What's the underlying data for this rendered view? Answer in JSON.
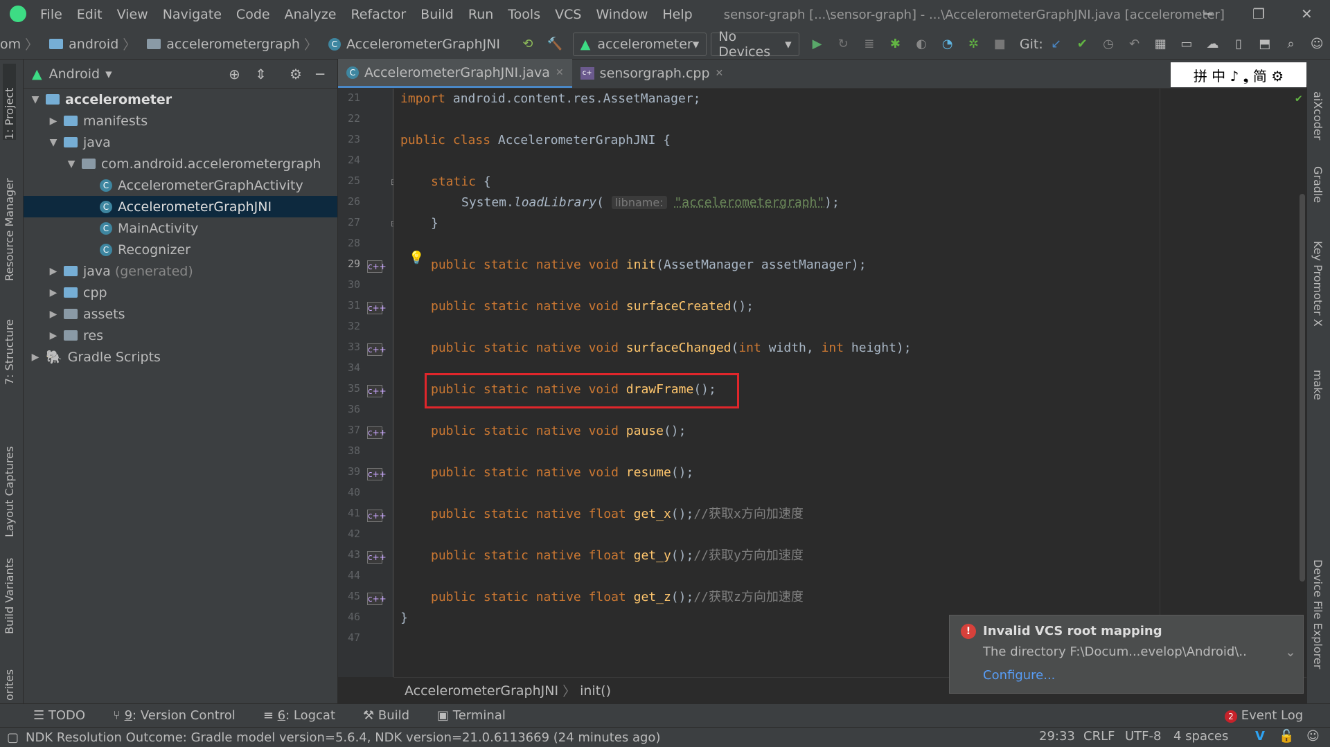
{
  "menu": [
    "File",
    "Edit",
    "View",
    "Navigate",
    "Code",
    "Analyze",
    "Refactor",
    "Build",
    "Run",
    "Tools",
    "VCS",
    "Window",
    "Help"
  ],
  "window_title": "sensor-graph [...\\sensor-graph] - ...\\AccelerometerGraphJNI.java [accelerometer]",
  "nav": {
    "crumbs": [
      "om",
      "android",
      "accelerometergraph",
      "AccelerometerGraphJNI"
    ],
    "run_config": "accelerometer",
    "device": "No Devices",
    "git_label": "Git:"
  },
  "project_panel": {
    "view": "Android",
    "tree": [
      {
        "label": "accelerometer",
        "bold": true
      },
      {
        "label": "manifests"
      },
      {
        "label": "java"
      },
      {
        "label": "com.android.accelerometergraph"
      },
      {
        "label": "AccelerometerGraphActivity"
      },
      {
        "label": "AccelerometerGraphJNI",
        "selected": true
      },
      {
        "label": "MainActivity"
      },
      {
        "label": "Recognizer"
      },
      {
        "label": "java",
        "suffix": "(generated)"
      },
      {
        "label": "cpp"
      },
      {
        "label": "assets"
      },
      {
        "label": "res"
      },
      {
        "label": "Gradle Scripts"
      }
    ]
  },
  "left_stripe": [
    "1: Project",
    "Resource Manager",
    "7: Structure",
    "Layout Captures",
    "Build Variants",
    "orites"
  ],
  "right_stripe": [
    "aiXcoder",
    "Gradle",
    "Key Promoter X",
    "make",
    "Device File Explorer"
  ],
  "tabs": [
    {
      "label": "AccelerometerGraphJNI.java",
      "active": true
    },
    {
      "label": "sensorgraph.cpp",
      "active": false
    }
  ],
  "ime_bar": "拼 中 ♪ ❟ 简 ⚙",
  "line_numbers": [
    "21",
    "22",
    "23",
    "24",
    "25",
    "26",
    "27",
    "28",
    "29",
    "30",
    "31",
    "32",
    "33",
    "34",
    "35",
    "36",
    "37",
    "38",
    "39",
    "40",
    "41",
    "42",
    "43",
    "44",
    "45",
    "46",
    "47"
  ],
  "code": {
    "l21_kw": "import",
    "l21_rest": " android.content.res.AssetManager;",
    "l23_kw": "public class",
    "l23_rest": " AccelerometerGraphJNI {",
    "l25_kw": "static",
    "l25_rest": " {",
    "l26_a": "System.",
    "l26_fn": "loadLibrary",
    "l26_paren": "(",
    "l26_hint": "libname:",
    "l26_str": "\"accelerometergraph\"",
    "l26_end": ");",
    "l27": "}",
    "l29_kw": "public static native void",
    "l29_fn": "init",
    "l29_rest": "(AssetManager assetManager);",
    "l31_kw": "public static native void",
    "l31_fn": "surfaceCreated",
    "l31_rest": "();",
    "l33_kw": "public static native void",
    "l33_fn": "surfaceChanged",
    "l33_a": "(",
    "l33_int1": "int",
    "l33_b": " width, ",
    "l33_int2": "int",
    "l33_c": " height);",
    "l35_kw": "public static native void",
    "l35_fn": "drawFrame",
    "l35_rest": "();",
    "l37_kw": "public static native void",
    "l37_fn": "pause",
    "l37_rest": "();",
    "l39_kw": "public static native void",
    "l39_fn": "resume",
    "l39_rest": "();",
    "l41_kw": "public static native float",
    "l41_fn": "get_x",
    "l41_rest": "();",
    "l41_cm": "//获取x方向加速度",
    "l43_kw": "public static native float",
    "l43_fn": "get_y",
    "l43_rest": "();",
    "l43_cm": "//获取y方向加速度",
    "l45_kw": "public static native float",
    "l45_fn": "get_z",
    "l45_rest": "();",
    "l45_cm": "//获取z方向加速度",
    "l46": "}"
  },
  "editor_breadcrumb": [
    "AccelerometerGraphJNI",
    "init()"
  ],
  "notification": {
    "title": "Invalid VCS root mapping",
    "body": "The directory F:\\Docum...evelop\\Android\\..",
    "link": "Configure..."
  },
  "bottom_tools": [
    {
      "key": "",
      "label": "TODO"
    },
    {
      "key": "9",
      "label": ": Version Control"
    },
    {
      "key": "6",
      "label": ": Logcat"
    },
    {
      "key": "",
      "label": "Build"
    },
    {
      "key": "",
      "label": "Terminal"
    }
  ],
  "event_log": {
    "count": "2",
    "label": "Event Log"
  },
  "status": {
    "message": "NDK Resolution Outcome: Gradle model version=5.6.4, NDK version=21.0.6113669 (24 minutes ago)",
    "position": "29:33",
    "line_sep": "CRLF",
    "encoding": "UTF-8",
    "indent": "4 spaces"
  },
  "colors": {
    "keyword": "#cc7832",
    "function": "#ffc66d",
    "string": "#6a8759",
    "comment": "#808080",
    "highlight_box": "#e0262b",
    "accent": "#4a88c7"
  }
}
